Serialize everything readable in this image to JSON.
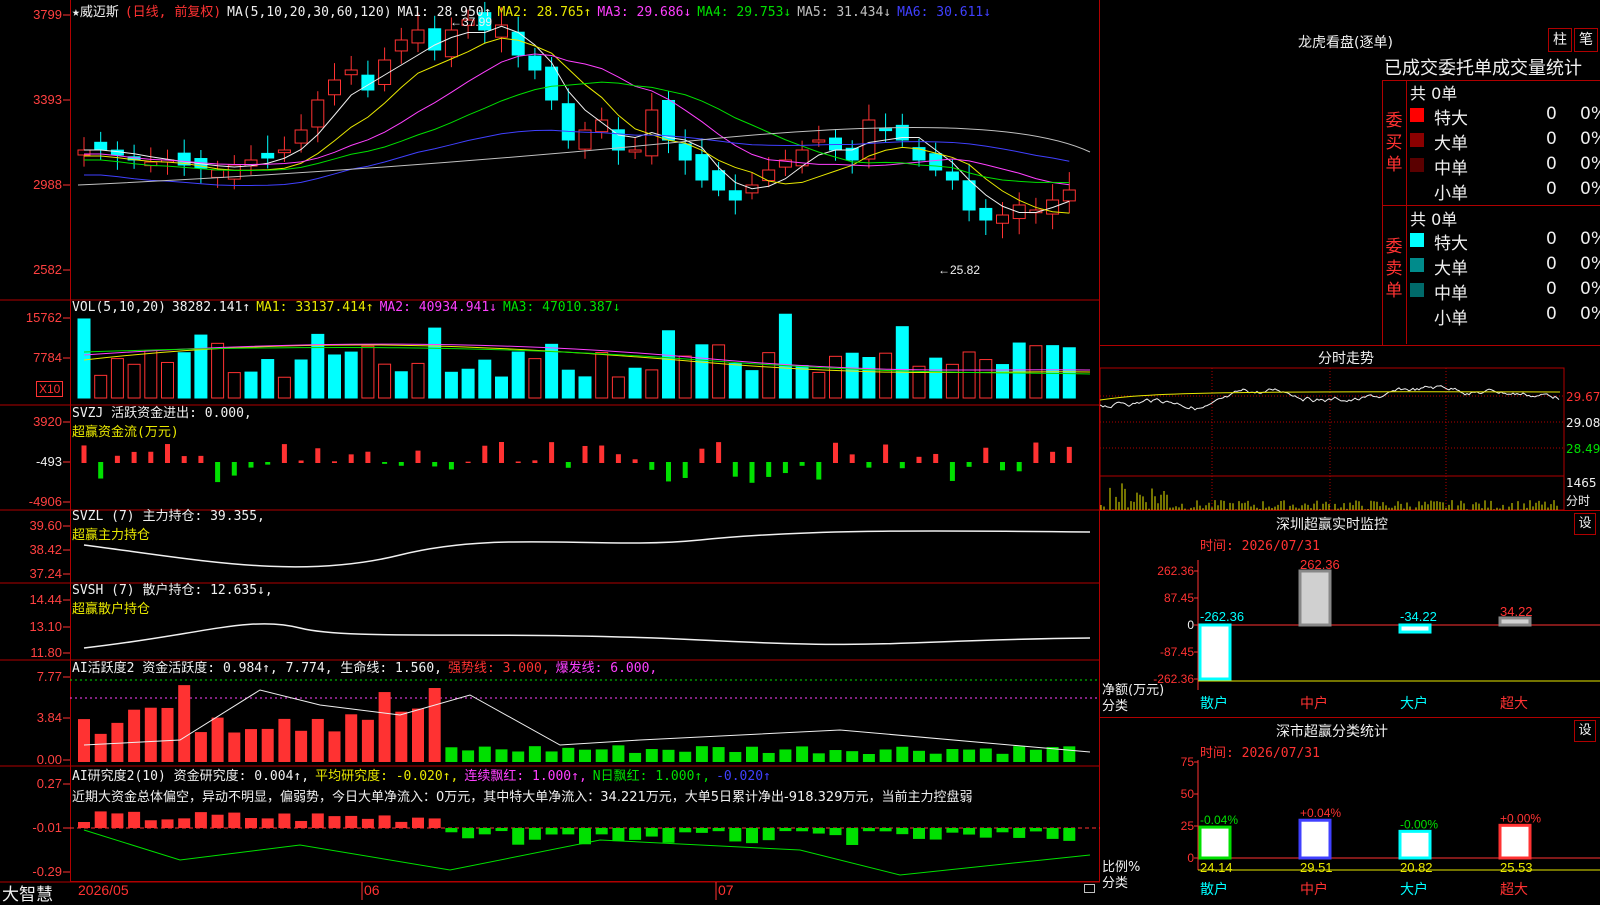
{
  "app": {
    "brand": "大智慧"
  },
  "stock": {
    "star": "★",
    "name": "威迈斯",
    "mode": "(日线, 前复权)"
  },
  "colors": {
    "up": "#ff3232",
    "down": "#00ffff",
    "green": "#00e000",
    "yellow": "#e8e800",
    "magenta": "#ff40ff",
    "blue": "#4040ff",
    "white": "#f0f0f0",
    "frame": "#b00000"
  },
  "main_chart": {
    "ma_label": "MA(5,10,20,30,60,120)",
    "ma_values": [
      {
        "label": "MA1: 28.950↑",
        "color": "#f0f0f0"
      },
      {
        "label": "MA2: 28.765↑",
        "color": "#e8e800"
      },
      {
        "label": "MA3: 29.686↓",
        "color": "#ff40ff"
      },
      {
        "label": "MA4: 29.753↓",
        "color": "#00e000"
      },
      {
        "label": "MA5: 31.434↓",
        "color": "#c0c0c0"
      },
      {
        "label": "MA6: 30.611↓",
        "color": "#4040ff"
      }
    ],
    "y_ticks": [
      "3799",
      "3393",
      "2988",
      "2582"
    ],
    "high_label": "←37.99",
    "low_label": "←25.82"
  },
  "vol_panel": {
    "title": "VOL(5,10,20)",
    "values": [
      {
        "label": "38282.141↑",
        "color": "#f0f0f0"
      },
      {
        "label": "MA1: 33137.414↑",
        "color": "#e8e800"
      },
      {
        "label": "MA2: 40934.941↓",
        "color": "#ff40ff"
      },
      {
        "label": "MA3: 47010.387↓",
        "color": "#00e000"
      }
    ],
    "y_ticks": [
      "15762",
      "7784"
    ],
    "unit": "X10"
  },
  "svzj_panel": {
    "title": "SVZJ  活跃资金进出: 0.000,",
    "subtitle": "超赢资金流(万元)",
    "y_ticks": [
      "3920",
      "-493",
      "-4906"
    ]
  },
  "svzl_panel": {
    "title": "SVZL (7) 主力持仓: 39.355,",
    "subtitle": "超赢主力持仓",
    "y_ticks": [
      "39.60",
      "38.42",
      "37.24"
    ]
  },
  "svsh_panel": {
    "title": "SVSH (7) 散户持仓: 12.635↓,",
    "subtitle": "超赢散户持仓",
    "y_ticks": [
      "14.44",
      "13.10",
      "11.80"
    ]
  },
  "ai_hyd_panel": {
    "title": "AI活跃度2 资金活跃度: 0.984↑, 7.774, 生命线: 1.560,",
    "strong_line": "强势线: 3.000,",
    "burst_line": "爆发线: 6.000,",
    "y_ticks": [
      "7.77",
      "3.84",
      "0.00"
    ]
  },
  "ai_yjd_panel": {
    "title": "AI研究度2(10) 资金研究度: 0.004↑,",
    "extras": [
      {
        "label": "平均研究度: -0.020↑,",
        "color": "#e8e800"
      },
      {
        "label": "连续飘红: 1.000↑,",
        "color": "#ff40ff"
      },
      {
        "label": "N日飘红: 1.000↑,",
        "color": "#00e000"
      },
      {
        "label": "-0.020↑",
        "color": "#4040ff"
      }
    ],
    "comment": "近期大资金总体偏空，异动不明显，偏弱势，今日大单净流入：0万元，其中特大单净流入：34.221万元，大单5日累计净出-918.329万元，当前主力控盘弱",
    "y_ticks": [
      "0.27",
      "-0.01",
      "-0.29"
    ]
  },
  "x_axis": {
    "labels": [
      "2026/05",
      "06",
      "07"
    ]
  },
  "dragon_tiger": {
    "title": "龙虎看盘(逐单)",
    "btn_bar": "柱",
    "btn_tick": "笔",
    "header": "已成交委托单成交量统计",
    "buy": {
      "label_chars": [
        "委",
        "买",
        "单"
      ],
      "total": "共 0单",
      "rows": [
        {
          "name": "特大",
          "v": "0",
          "p": "0%",
          "color": "#ff0000"
        },
        {
          "name": "大单",
          "v": "0",
          "p": "0%",
          "color": "#8b0000"
        },
        {
          "name": "中单",
          "v": "0",
          "p": "0%",
          "color": "#5a0000"
        },
        {
          "name": "小单",
          "v": "0",
          "p": "0%",
          "color": "#000000"
        }
      ]
    },
    "sell": {
      "label_chars": [
        "委",
        "卖",
        "单"
      ],
      "total": "共 0单",
      "rows": [
        {
          "name": "特大",
          "v": "0",
          "p": "0%",
          "color": "#00ffff"
        },
        {
          "name": "大单",
          "v": "0",
          "p": "0%",
          "color": "#008b8b"
        },
        {
          "name": "中单",
          "v": "0",
          "p": "0%",
          "color": "#006a6a"
        },
        {
          "name": "小单",
          "v": "0",
          "p": "0%",
          "color": "#000000"
        }
      ]
    }
  },
  "intraday": {
    "title": "分时走势",
    "price_ticks": [
      "29.67",
      "29.08",
      "28.49"
    ],
    "vol_tick": "1465",
    "vol_unit": "分时"
  },
  "sz_monitor": {
    "title": "深圳超赢实时监控",
    "settings": "设",
    "time": "时间: 2026/07/31",
    "y_ticks": [
      "262.36",
      "87.45",
      "0",
      "-87.45",
      "-262.36"
    ],
    "net_label": "净额(万元)",
    "cat_label": "分类",
    "bars": [
      {
        "cat": "散户",
        "value": -262.36,
        "label": "-262.36"
      },
      {
        "cat": "中户",
        "value": 262.36,
        "label": "262.36"
      },
      {
        "cat": "大户",
        "value": -34.22,
        "label": "-34.22"
      },
      {
        "cat": "超大",
        "value": 34.22,
        "label": "34.22"
      }
    ]
  },
  "sz_class": {
    "title": "深市超赢分类统计",
    "settings": "设",
    "time": "时间: 2026/07/31",
    "y_ticks": [
      "75",
      "50",
      "25",
      "0"
    ],
    "ratio_label": "比例%",
    "cat_label": "分类",
    "bars": [
      {
        "cat": "散户",
        "value": 24.14,
        "change": "-0.04%"
      },
      {
        "cat": "中户",
        "value": 29.51,
        "change": "+0.04%"
      },
      {
        "cat": "大户",
        "value": 20.82,
        "change": "-0.00%"
      },
      {
        "cat": "超大",
        "value": 25.53,
        "change": "+0.00%"
      }
    ]
  }
}
